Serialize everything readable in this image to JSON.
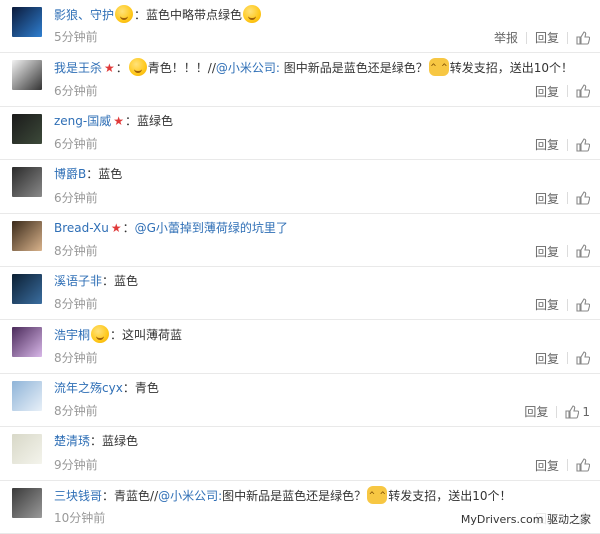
{
  "colors": {
    "user_link": "#2f6fb6",
    "time": "#999999",
    "vip_badge": "#e03a3a"
  },
  "action_labels": {
    "report": "举报",
    "reply": "回复"
  },
  "comments": [
    {
      "user": "影狼、守护",
      "badge": "vip-face",
      "text": "蓝色中略带点绿色",
      "time": "5分钟前",
      "report": true,
      "likes": "",
      "avatar": [
        "#0b1a3a",
        "#2f7fd0"
      ]
    },
    {
      "user": "我是王杀",
      "badge": "vip-star",
      "text": "青色！！！//@小米公司: 图中新品是蓝色还是绿色？",
      "text_tail": "转发支招，送出10个！",
      "time": "6分钟前",
      "report": false,
      "likes": "",
      "avatar": [
        "#f2f2f2",
        "#333333"
      ]
    },
    {
      "user": "zeng-国威",
      "badge": "vip-star",
      "text": "蓝绿色",
      "time": "6分钟前",
      "report": false,
      "likes": "",
      "avatar": [
        "#1a1a1a",
        "#3d4a3a"
      ]
    },
    {
      "user": "博爵B",
      "badge": "",
      "text": "蓝色",
      "time": "6分钟前",
      "report": false,
      "likes": "",
      "avatar": [
        "#2a2a2a",
        "#8a8a8a"
      ]
    },
    {
      "user": "Bread-Xu",
      "badge": "vip-star",
      "text": "@G小蕾掉到薄荷绿的坑里了",
      "time": "8分钟前",
      "report": false,
      "likes": "",
      "avatar": [
        "#3a2a1a",
        "#d9b38c"
      ]
    },
    {
      "user": "溪语子非",
      "badge": "",
      "text": "蓝色",
      "time": "8分钟前",
      "report": false,
      "likes": "",
      "avatar": [
        "#0b1f33",
        "#3b6ea0"
      ]
    },
    {
      "user": "浩宇桐",
      "badge": "vip-face",
      "text": "这叫薄荷蓝",
      "time": "8分钟前",
      "report": false,
      "likes": "",
      "avatar": [
        "#4a2a5a",
        "#d8b7e8"
      ]
    },
    {
      "user": "流年之殇cyx",
      "badge": "",
      "text": "青色",
      "time": "8分钟前",
      "report": false,
      "likes": "1",
      "avatar": [
        "#8fb4d8",
        "#e8f0f8"
      ]
    },
    {
      "user": "楚清琇",
      "badge": "",
      "text": "蓝绿色",
      "time": "9分钟前",
      "report": false,
      "likes": "",
      "avatar": [
        "#d8d8c8",
        "#f4f4ec"
      ]
    },
    {
      "user": "三块钱哥",
      "badge": "",
      "text": "青蓝色//@小米公司:图中新品是蓝色还是绿色？",
      "text_tail": "转发支招，送出10个！",
      "time": "10分钟前",
      "report": false,
      "likes": "",
      "avatar": [
        "#3a3a3a",
        "#9a9a9a"
      ]
    }
  ],
  "watermark": "MyDrivers.com 驱动之家"
}
